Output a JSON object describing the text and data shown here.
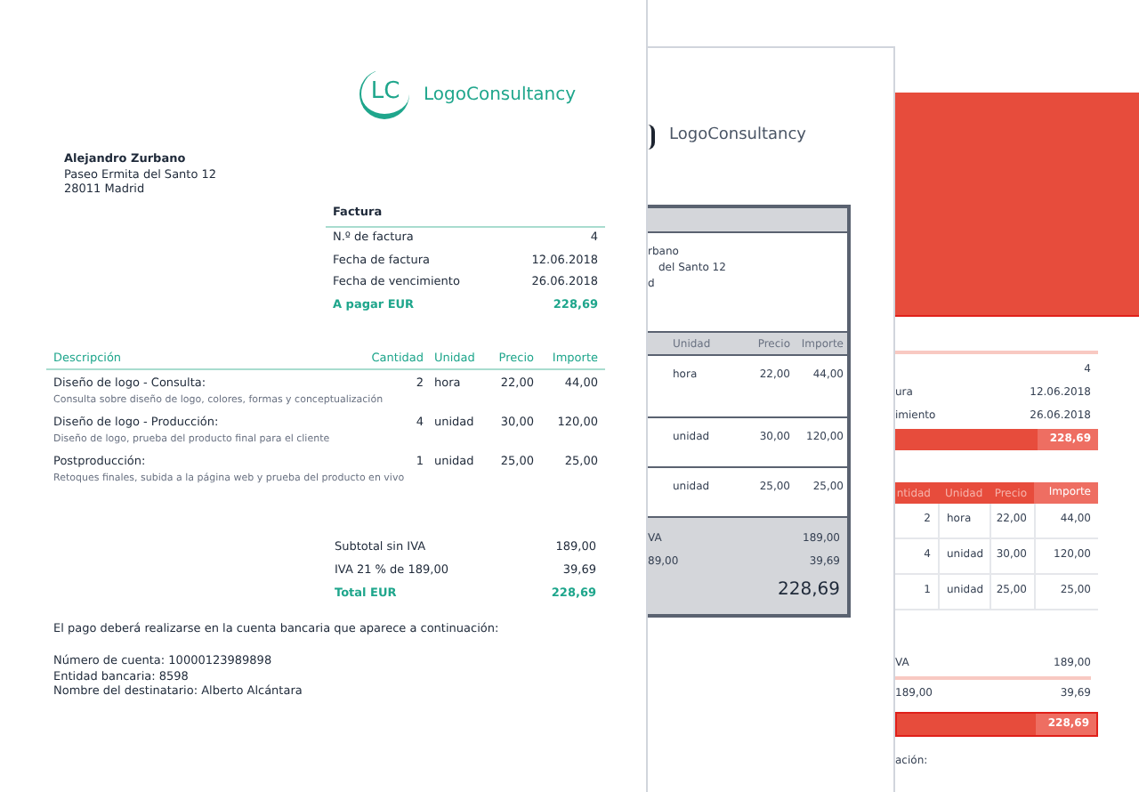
{
  "front_page": {
    "monogram": "LC",
    "brand": "LogoConsultancy",
    "client": {
      "name": "Alejandro Zurbano",
      "lines": [
        "Paseo Ermita del Santo 12",
        "28011 Madrid"
      ]
    },
    "invoice": {
      "title": "Factura",
      "fields": [
        {
          "label": "N.º de factura",
          "value": "4"
        },
        {
          "label": "Fecha de factura",
          "value": "12.06.2018"
        },
        {
          "label": "Fecha de vencimiento",
          "value": "26.06.2018"
        }
      ],
      "due": {
        "label": "A pagar EUR",
        "value": "228,69"
      }
    },
    "items": {
      "columns": [
        "Descripción",
        "Cantidad",
        "Unidad",
        "Precio",
        "Importe"
      ],
      "rows": [
        {
          "name": "Diseño de logo - Consulta:",
          "detail": "Consulta sobre diseño de logo, colores, formas y conceptualización",
          "quantity": "2",
          "unit": "hora",
          "price": "22,00",
          "amount": "44,00"
        },
        {
          "name": "Diseño de logo - Producción:",
          "detail": "Diseño de logo, prueba del producto final para el cliente",
          "quantity": "4",
          "unit": "unidad",
          "price": "30,00",
          "amount": "120,00"
        },
        {
          "name": "Postproducción:",
          "detail": "Retoques finales, subida a la página web y prueba del producto en vivo",
          "quantity": "1",
          "unit": "unidad",
          "price": "25,00",
          "amount": "25,00"
        }
      ]
    },
    "totals": [
      {
        "label": "Subtotal sin IVA",
        "value": "189,00"
      },
      {
        "label": "IVA 21 % de 189,00",
        "value": "39,69"
      }
    ],
    "total": {
      "label": "Total EUR",
      "value": "228,69"
    },
    "payment_note": "El pago deberá realizarse en la cuenta bancaria que aparece a continuación:",
    "bank_lines": [
      "Número de cuenta: 10000123989898",
      "Entidad bancaria: 8598",
      "Nombre del destinatario: Alberto Alcántara"
    ]
  },
  "middle_page": {
    "brand": "LogoConsultancy",
    "address_lines": [
      "rbano",
      "del Santo 12",
      "d"
    ],
    "columns": [
      "Unidad",
      "Precio",
      "Importe"
    ],
    "rows": [
      [
        "hora",
        "22,00",
        "44,00"
      ],
      [
        "unidad",
        "30,00",
        "120,00"
      ],
      [
        "unidad",
        "25,00",
        "25,00"
      ]
    ],
    "totals": [
      [
        "VA",
        "189,00"
      ],
      [
        "89,00",
        "39,69"
      ]
    ],
    "total": "228,69"
  },
  "back_page": {
    "invoice_rows": [
      {
        "value": "4"
      },
      {
        "label": "ura",
        "value": "12.06.2018"
      },
      {
        "label": "imiento",
        "value": "26.06.2018"
      }
    ],
    "due": "228,69",
    "columns": [
      "ntidad",
      "Unidad",
      "Precio",
      "Importe"
    ],
    "rows": [
      [
        "2",
        "hora",
        "22,00",
        "44,00"
      ],
      [
        "4",
        "unidad",
        "30,00",
        "120,00"
      ],
      [
        "1",
        "unidad",
        "25,00",
        "25,00"
      ]
    ],
    "totals": [
      [
        "VA",
        "189,00"
      ],
      [
        "189,00",
        "39,69"
      ]
    ],
    "total": "228,69",
    "note": "ación:"
  }
}
